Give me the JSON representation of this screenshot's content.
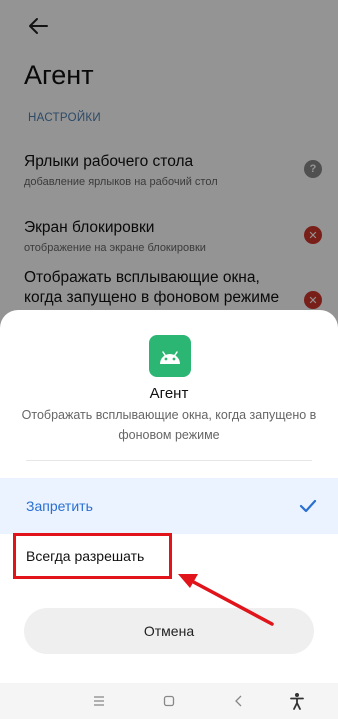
{
  "header": {
    "title": "Агент",
    "back_icon": "arrow-left-icon"
  },
  "section": {
    "label": "НАСТРОЙКИ"
  },
  "settings": [
    {
      "title": "Ярлыки рабочего стола",
      "subtitle": "добавление ярлыков на рабочий стол",
      "status_icon": "help-icon"
    },
    {
      "title": "Экран блокировки",
      "subtitle": "отображение на экране блокировки",
      "status_icon": "deny-icon"
    },
    {
      "title": "Отображать всплывающие окна, когда запущено в фоновом режиме",
      "status_icon": "deny-icon"
    }
  ],
  "dialog": {
    "app_icon": "android-icon",
    "app_name": "Агент",
    "description": "Отображать всплывающие окна, когда запущено в фоновом режиме",
    "options": [
      {
        "label": "Запретить",
        "selected": true
      },
      {
        "label": "Всегда разрешать",
        "selected": false
      }
    ],
    "cancel_label": "Отмена"
  },
  "navbar": {
    "icons": [
      "menu-icon",
      "home-icon",
      "back-icon",
      "accessibility-icon"
    ]
  },
  "colors": {
    "accent": "#2a6fd1",
    "selected_bg": "#eaf3ff",
    "deny": "#d0362c",
    "highlight": "#e0141a",
    "app_icon_bg": "#2bb674"
  }
}
